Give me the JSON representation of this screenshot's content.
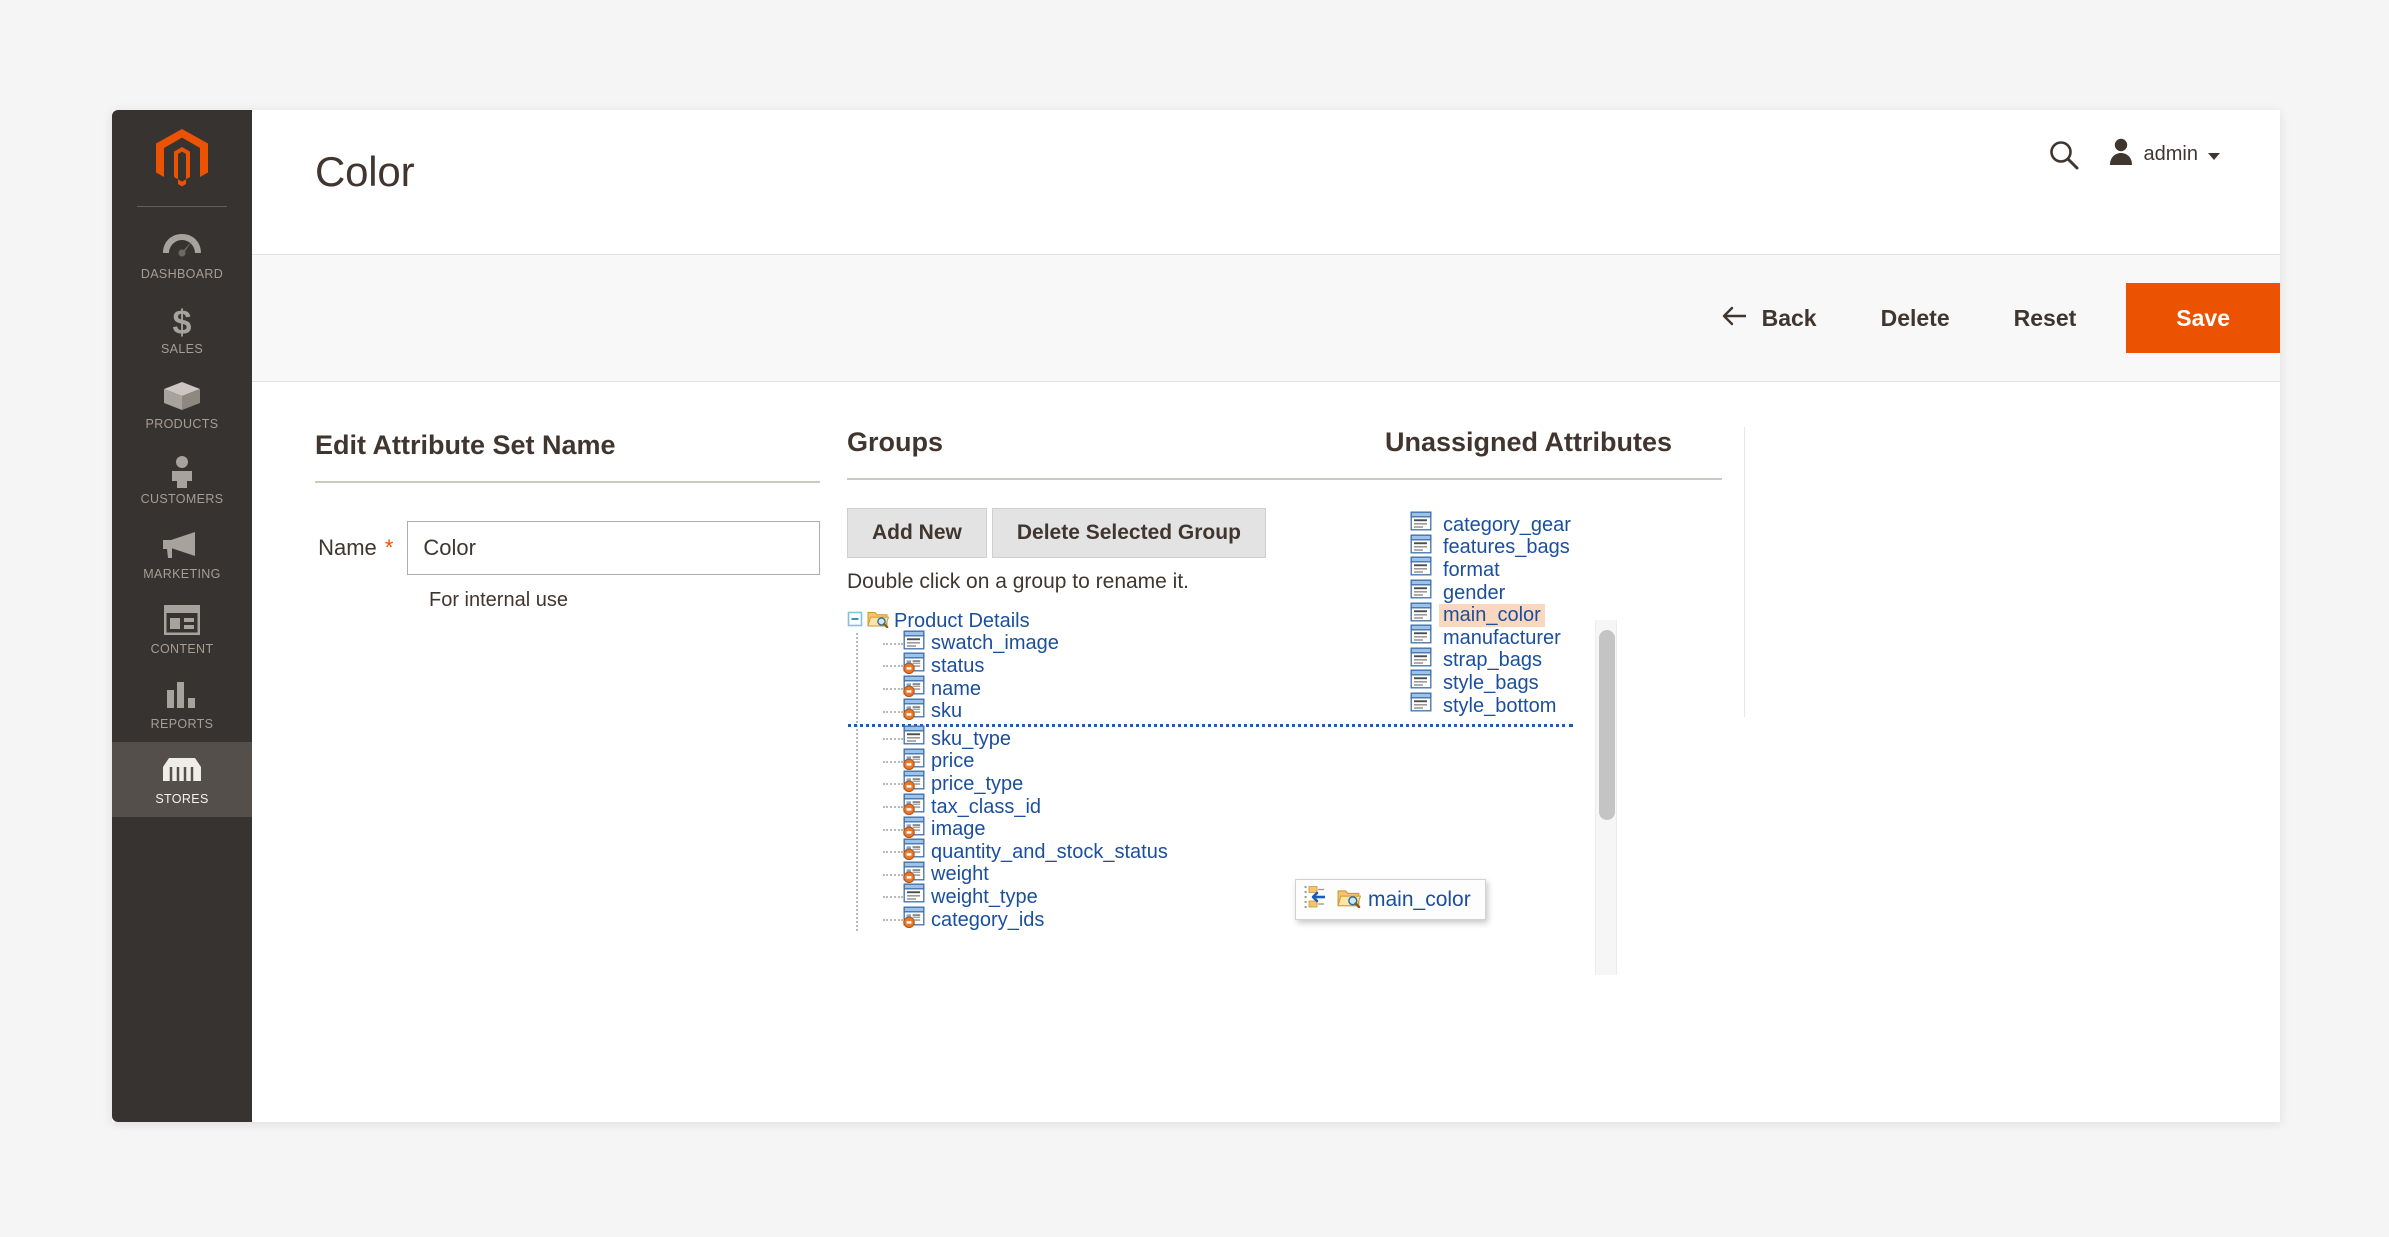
{
  "app": {
    "brand_icon": "magento-logo-icon",
    "accent_color": "#eb5202",
    "sidebar_bg": "#373330"
  },
  "sidebar": {
    "items": [
      {
        "label": "DASHBOARD",
        "icon": "dashboard-gauge-icon",
        "active": false
      },
      {
        "label": "SALES",
        "icon": "dollar-sign-icon",
        "active": false
      },
      {
        "label": "PRODUCTS",
        "icon": "box-icon",
        "active": false
      },
      {
        "label": "CUSTOMERS",
        "icon": "person-icon",
        "active": false
      },
      {
        "label": "MARKETING",
        "icon": "megaphone-icon",
        "active": false
      },
      {
        "label": "CONTENT",
        "icon": "layout-icon",
        "active": false
      },
      {
        "label": "REPORTS",
        "icon": "bar-chart-icon",
        "active": false
      },
      {
        "label": "STORES",
        "icon": "storefront-icon",
        "active": true
      }
    ]
  },
  "header": {
    "title": "Color",
    "search_icon": "search-icon",
    "user_icon": "user-avatar-icon",
    "user_name": "admin",
    "caret_icon": "chevron-down-icon"
  },
  "action_bar": {
    "back_label": "Back",
    "back_icon": "arrow-left-icon",
    "delete_label": "Delete",
    "reset_label": "Reset",
    "save_label": "Save"
  },
  "left_panel": {
    "heading": "Edit Attribute Set Name",
    "name_label": "Name",
    "required_marker": "*",
    "name_value": "Color",
    "name_placeholder": "",
    "note": "For internal use"
  },
  "groups_panel": {
    "heading": "Groups",
    "add_new_label": "Add New",
    "delete_group_label": "Delete Selected Group",
    "hint": "Double click on a group to rename it.",
    "root": {
      "label": "Product Details",
      "icon": "folder-search-icon",
      "expander_icon": "minus-box-icon",
      "expanded": true
    },
    "attributes": [
      {
        "label": "swatch_image",
        "icon": "form-icon",
        "locked": false
      },
      {
        "label": "status",
        "icon": "form-lock-icon",
        "locked": true
      },
      {
        "label": "name",
        "icon": "form-lock-icon",
        "locked": true
      },
      {
        "label": "sku",
        "icon": "form-lock-icon",
        "locked": true
      },
      {
        "label": "sku_type",
        "icon": "form-icon",
        "locked": false
      },
      {
        "label": "price",
        "icon": "form-lock-icon",
        "locked": true
      },
      {
        "label": "price_type",
        "icon": "form-lock-icon",
        "locked": true
      },
      {
        "label": "tax_class_id",
        "icon": "form-lock-icon",
        "locked": true
      },
      {
        "label": "image",
        "icon": "form-lock-icon",
        "locked": true
      },
      {
        "label": "quantity_and_stock_status",
        "icon": "form-lock-icon",
        "locked": true
      },
      {
        "label": "weight",
        "icon": "form-lock-icon",
        "locked": true
      },
      {
        "label": "weight_type",
        "icon": "form-icon",
        "locked": false
      },
      {
        "label": "category_ids",
        "icon": "form-lock-icon",
        "locked": true
      }
    ],
    "drop_indicator_after_index": 3
  },
  "drag_proxy": {
    "label": "main_color",
    "insert_icon": "tree-insert-icon",
    "folder_icon": "folder-search-icon"
  },
  "unassigned_panel": {
    "heading": "Unassigned Attributes",
    "attributes": [
      {
        "label": "category_gear",
        "icon": "form-icon",
        "selected": false
      },
      {
        "label": "features_bags",
        "icon": "form-icon",
        "selected": false
      },
      {
        "label": "format",
        "icon": "form-icon",
        "selected": false
      },
      {
        "label": "gender",
        "icon": "form-icon",
        "selected": false
      },
      {
        "label": "main_color",
        "icon": "form-icon",
        "selected": true
      },
      {
        "label": "manufacturer",
        "icon": "form-icon",
        "selected": false
      },
      {
        "label": "strap_bags",
        "icon": "form-icon",
        "selected": false
      },
      {
        "label": "style_bags",
        "icon": "form-icon",
        "selected": false
      },
      {
        "label": "style_bottom",
        "icon": "form-icon",
        "selected": false
      }
    ],
    "highlight_color": "#fad8c0"
  }
}
